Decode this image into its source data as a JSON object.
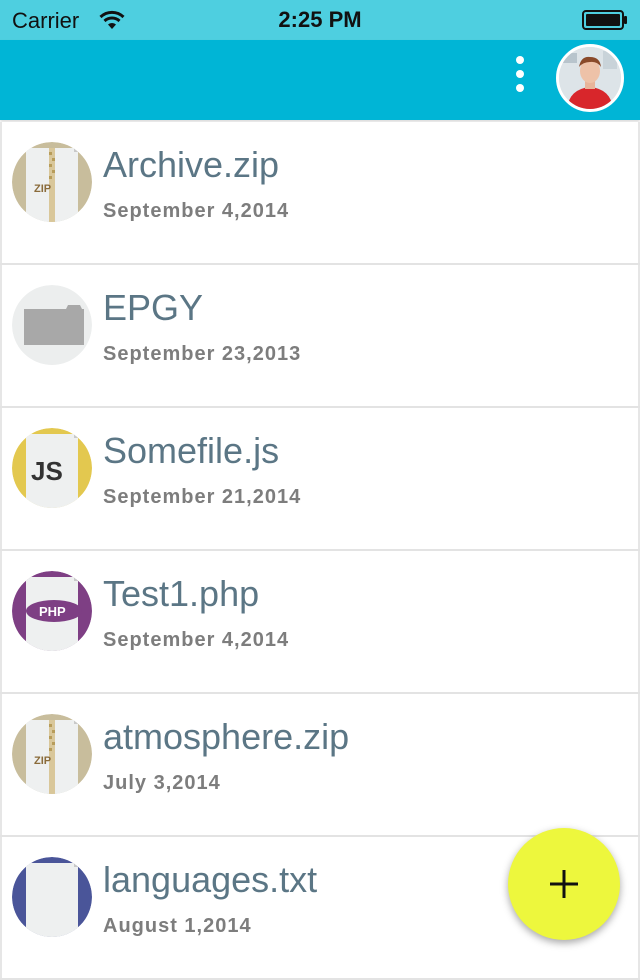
{
  "status_bar": {
    "carrier": "Carrier",
    "time": "2:25 PM",
    "wifi_icon": "wifi-icon",
    "battery_icon": "battery-full-icon"
  },
  "app_bar": {
    "color": "#00b5d6",
    "menu_icon": "more-vertical-icon",
    "avatar_icon": "user-avatar"
  },
  "files": [
    {
      "name": "Archive.zip",
      "date": "September 4,2014",
      "type": "zip",
      "icon": "zip-file-icon"
    },
    {
      "name": "EPGY",
      "date": "September 23,2013",
      "type": "folder",
      "icon": "folder-icon"
    },
    {
      "name": "Somefile.js",
      "date": "September 21,2014",
      "type": "js",
      "icon": "js-file-icon",
      "icon_label": "JS"
    },
    {
      "name": "Test1.php",
      "date": "September 4,2014",
      "type": "php",
      "icon": "php-file-icon",
      "icon_label": "PHP"
    },
    {
      "name": "atmosphere.zip",
      "date": "July 3,2014",
      "type": "zip",
      "icon": "zip-file-icon"
    },
    {
      "name": "languages.txt",
      "date": "August 1,2014",
      "type": "txt",
      "icon": "txt-file-icon"
    }
  ],
  "zip_label": "ZIP",
  "fab": {
    "icon": "plus-icon",
    "color": "#edf73d"
  }
}
